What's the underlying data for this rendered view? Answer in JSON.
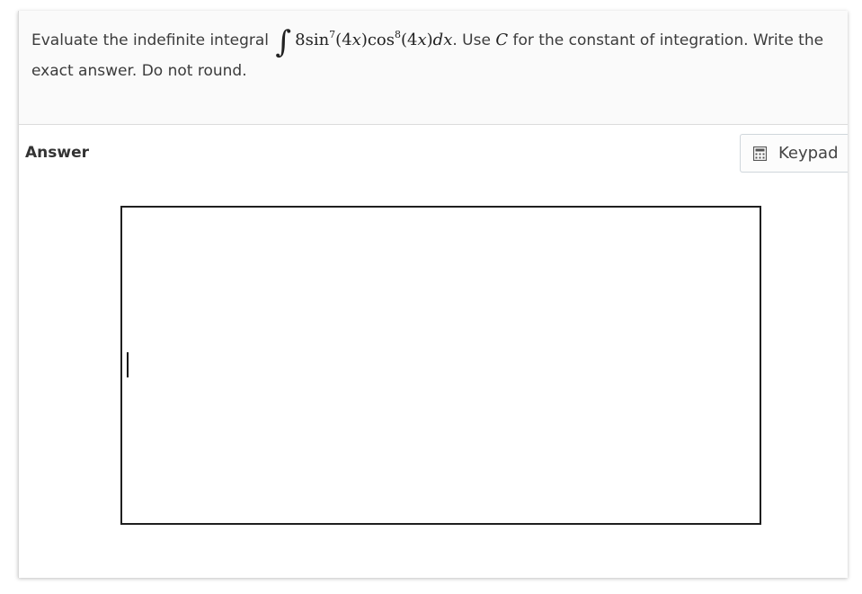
{
  "question": {
    "prefix": "Evaluate the indefinite integral",
    "integral_sign": "∫",
    "integrand": {
      "coefficient": "8",
      "f1": "sin",
      "exp1": "7",
      "arg1_open": "(4",
      "arg1_var": "x",
      "arg1_close": ")",
      "f2": "cos",
      "exp2": "8",
      "arg2_open": "(4",
      "arg2_var": "x",
      "arg2_close": ")",
      "differential": "dx"
    },
    "after_integral": ". Use",
    "constant_symbol": "C",
    "suffix_line1": "for the constant of integration. Write the",
    "line2": "exact answer. Do not round."
  },
  "answer": {
    "label": "Answer",
    "keypad_label": "Keypad",
    "input_value": ""
  },
  "colors": {
    "text": "#3b3b3b",
    "question_bg": "#fafafa",
    "answer_border": "#1f1f1f"
  }
}
